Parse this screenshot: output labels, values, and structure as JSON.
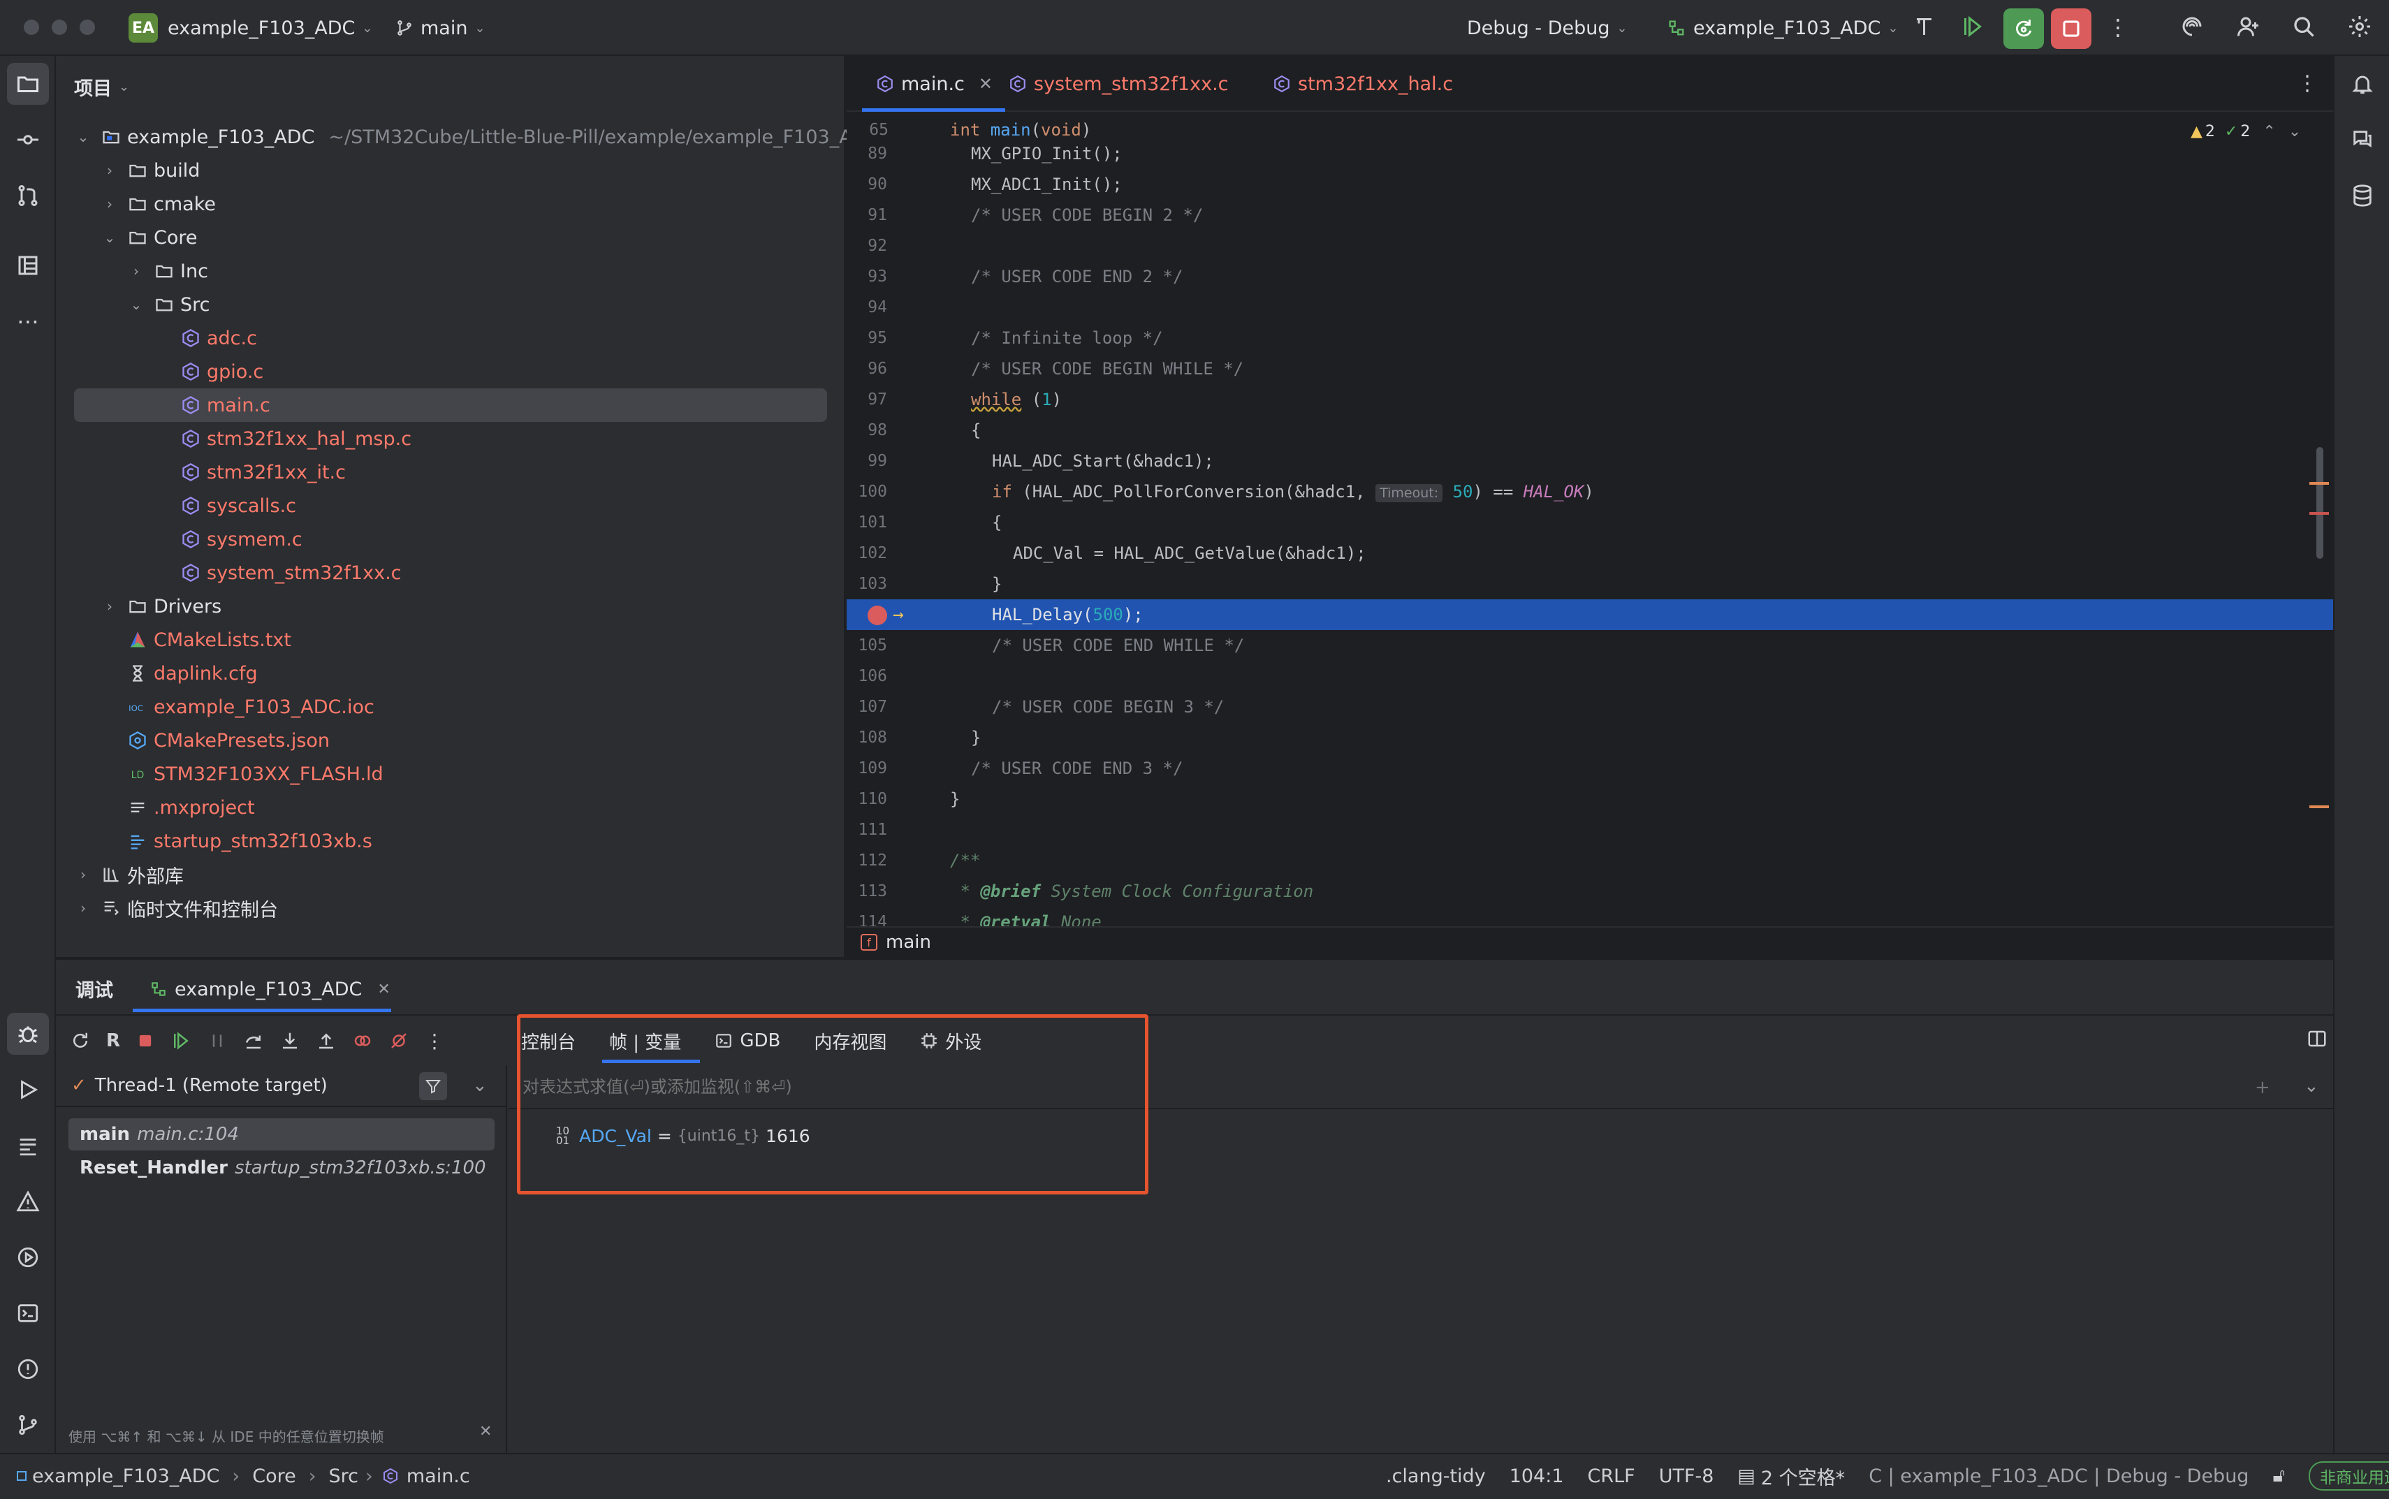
{
  "titlebar": {
    "project_badge": "EA",
    "project_name": "example_F103_ADC",
    "branch": "main",
    "run_config": "Debug - Debug",
    "target": "example_F103_ADC"
  },
  "project_panel": {
    "title": "项目",
    "root": {
      "name": "example_F103_ADC",
      "path": "~/STM32Cube/Little-Blue-Pill/example/example_F103_ADC"
    },
    "items": [
      {
        "label": "build"
      },
      {
        "label": "cmake"
      },
      {
        "label": "Core"
      },
      {
        "label": "Inc"
      },
      {
        "label": "Src"
      },
      {
        "label": "adc.c"
      },
      {
        "label": "gpio.c"
      },
      {
        "label": "main.c"
      },
      {
        "label": "stm32f1xx_hal_msp.c"
      },
      {
        "label": "stm32f1xx_it.c"
      },
      {
        "label": "syscalls.c"
      },
      {
        "label": "sysmem.c"
      },
      {
        "label": "system_stm32f1xx.c"
      },
      {
        "label": "Drivers"
      },
      {
        "label": "CMakeLists.txt"
      },
      {
        "label": "daplink.cfg"
      },
      {
        "label": "example_F103_ADC.ioc"
      },
      {
        "label": "CMakePresets.json"
      },
      {
        "label": "STM32F103XX_FLASH.ld"
      },
      {
        "label": ".mxproject"
      },
      {
        "label": "startup_stm32f103xb.s"
      },
      {
        "label": "外部库"
      },
      {
        "label": "临时文件和控制台"
      }
    ]
  },
  "editor": {
    "tabs": [
      {
        "label": "main.c"
      },
      {
        "label": "system_stm32f1xx.c"
      },
      {
        "label": "stm32f1xx_hal.c"
      }
    ],
    "sticky_line_number": "65",
    "sticky_line": "int main(void)",
    "warnings_count": "2",
    "checks_count": "2",
    "lines": [
      {
        "n": "89",
        "code": "MX_GPIO_Init();"
      },
      {
        "n": "90",
        "code": "MX_ADC1_Init();"
      },
      {
        "n": "91",
        "code": "/* USER CODE BEGIN 2 */"
      },
      {
        "n": "92",
        "code": ""
      },
      {
        "n": "93",
        "code": "/* USER CODE END 2 */"
      },
      {
        "n": "94",
        "code": ""
      },
      {
        "n": "95",
        "code": "/* Infinite loop */"
      },
      {
        "n": "96",
        "code": "/* USER CODE BEGIN WHILE */"
      },
      {
        "n": "97",
        "code": "while (1)"
      },
      {
        "n": "98",
        "code": "{"
      },
      {
        "n": "99",
        "code": "HAL_ADC_Start(&hadc1);"
      },
      {
        "n": "100",
        "code": "if (HAL_ADC_PollForConversion(&hadc1, Timeout: 50) == HAL_OK)"
      },
      {
        "n": "101",
        "code": "{"
      },
      {
        "n": "102",
        "code": "ADC_Val = HAL_ADC_GetValue(&hadc1);"
      },
      {
        "n": "103",
        "code": "}"
      },
      {
        "n": "104",
        "code": "HAL_Delay(500);"
      },
      {
        "n": "105",
        "code": "/* USER CODE END WHILE */"
      },
      {
        "n": "106",
        "code": ""
      },
      {
        "n": "107",
        "code": "/* USER CODE BEGIN 3 */"
      },
      {
        "n": "108",
        "code": "}"
      },
      {
        "n": "109",
        "code": "/* USER CODE END 3 */"
      },
      {
        "n": "110",
        "code": "}"
      },
      {
        "n": "111",
        "code": ""
      },
      {
        "n": "112",
        "code": "/**"
      },
      {
        "n": "113",
        "code": "* @brief System Clock Configuration"
      },
      {
        "n": "114",
        "code": "* @retval None"
      }
    ],
    "breadcrumb_function": "main"
  },
  "debug": {
    "title": "调试",
    "session_tab": "example_F103_ADC",
    "subtabs": [
      {
        "label": "控制台"
      },
      {
        "label": "帧 | 变量"
      },
      {
        "label": "GDB"
      },
      {
        "label": "内存视图"
      },
      {
        "label": "外设"
      }
    ],
    "thread": "Thread-1 (Remote target)",
    "frames": [
      {
        "func": "main",
        "loc": "main.c:104"
      },
      {
        "func": "Reset_Handler",
        "loc": "startup_stm32f103xb.s:100"
      }
    ],
    "eval_placeholder": "对表达式求值(⏎)或添加监视(⇧⌘⏎)",
    "variables": [
      {
        "name": "ADC_Val",
        "type": "{uint16_t}",
        "value": "1616",
        "equals": "="
      }
    ],
    "hint": "使用 ⌥⌘↑ 和 ⌥⌘↓ 从 IDE 中的任意位置切换帧"
  },
  "statusbar": {
    "breadcrumbs": [
      "example_F103_ADC",
      "Core",
      "Src",
      "main.c"
    ],
    "linter": ".clang-tidy",
    "position": "104:1",
    "line_sep": "CRLF",
    "encoding": "UTF-8",
    "indent": "2 个空格*",
    "context": "C | example_F103_ADC | Debug - Debug",
    "license": "非商业用途"
  },
  "colors": {
    "accent": "#3574f0",
    "highlight_line": "#2154b0",
    "annotation_box": "#e5542f",
    "run_green": "#4e9a54",
    "stop_red": "#db5c5c"
  }
}
